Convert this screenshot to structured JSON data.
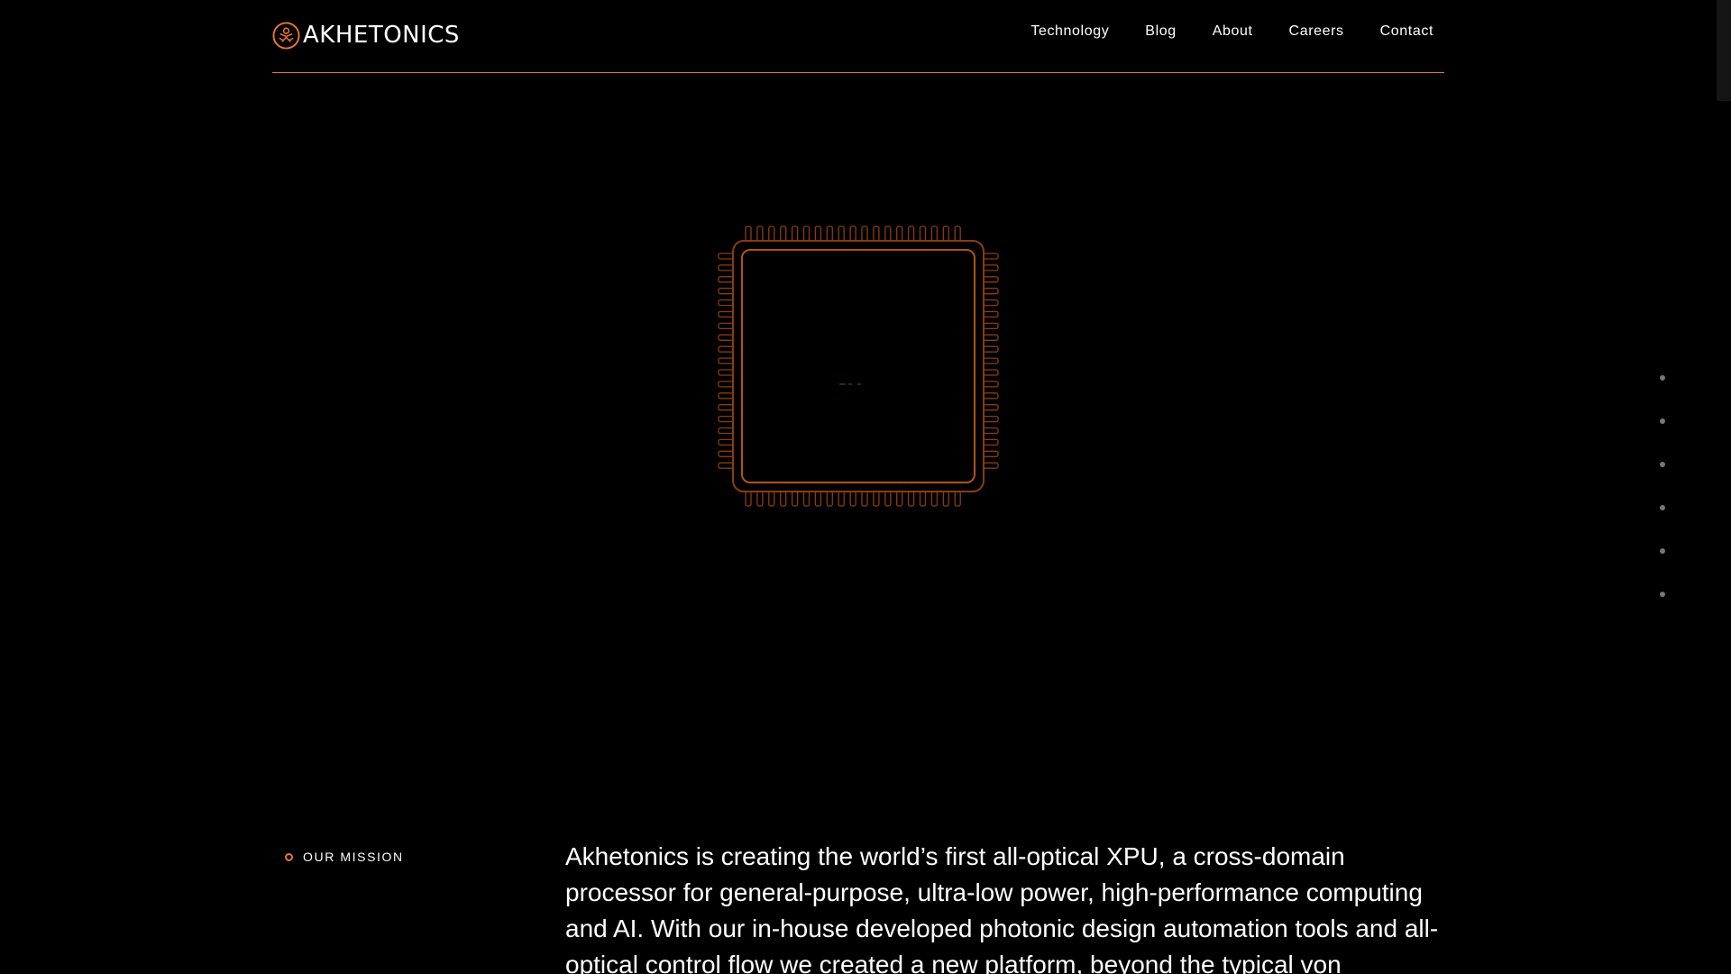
{
  "brand": {
    "name": "AKHETONICS",
    "logo_icon": "akhetonics-logo-icon",
    "accent_color": "#e8772e"
  },
  "nav": {
    "items": [
      {
        "label": "Technology"
      },
      {
        "label": "Blog"
      },
      {
        "label": "About"
      },
      {
        "label": "Careers"
      },
      {
        "label": "Contact"
      }
    ]
  },
  "hero": {
    "illustration": "photonic-chip-icon",
    "section_dot_count": 6
  },
  "mission": {
    "label": "OUR MISSION",
    "text": "Akhetonics is creating the world’s first all-optical XPU, a cross-domain processor for general-purpose, ultra-low power, high-performance computing and AI.  With our in-house developed photonic design automation tools and all-optical control flow we created a new platform, beyond the typical von"
  }
}
